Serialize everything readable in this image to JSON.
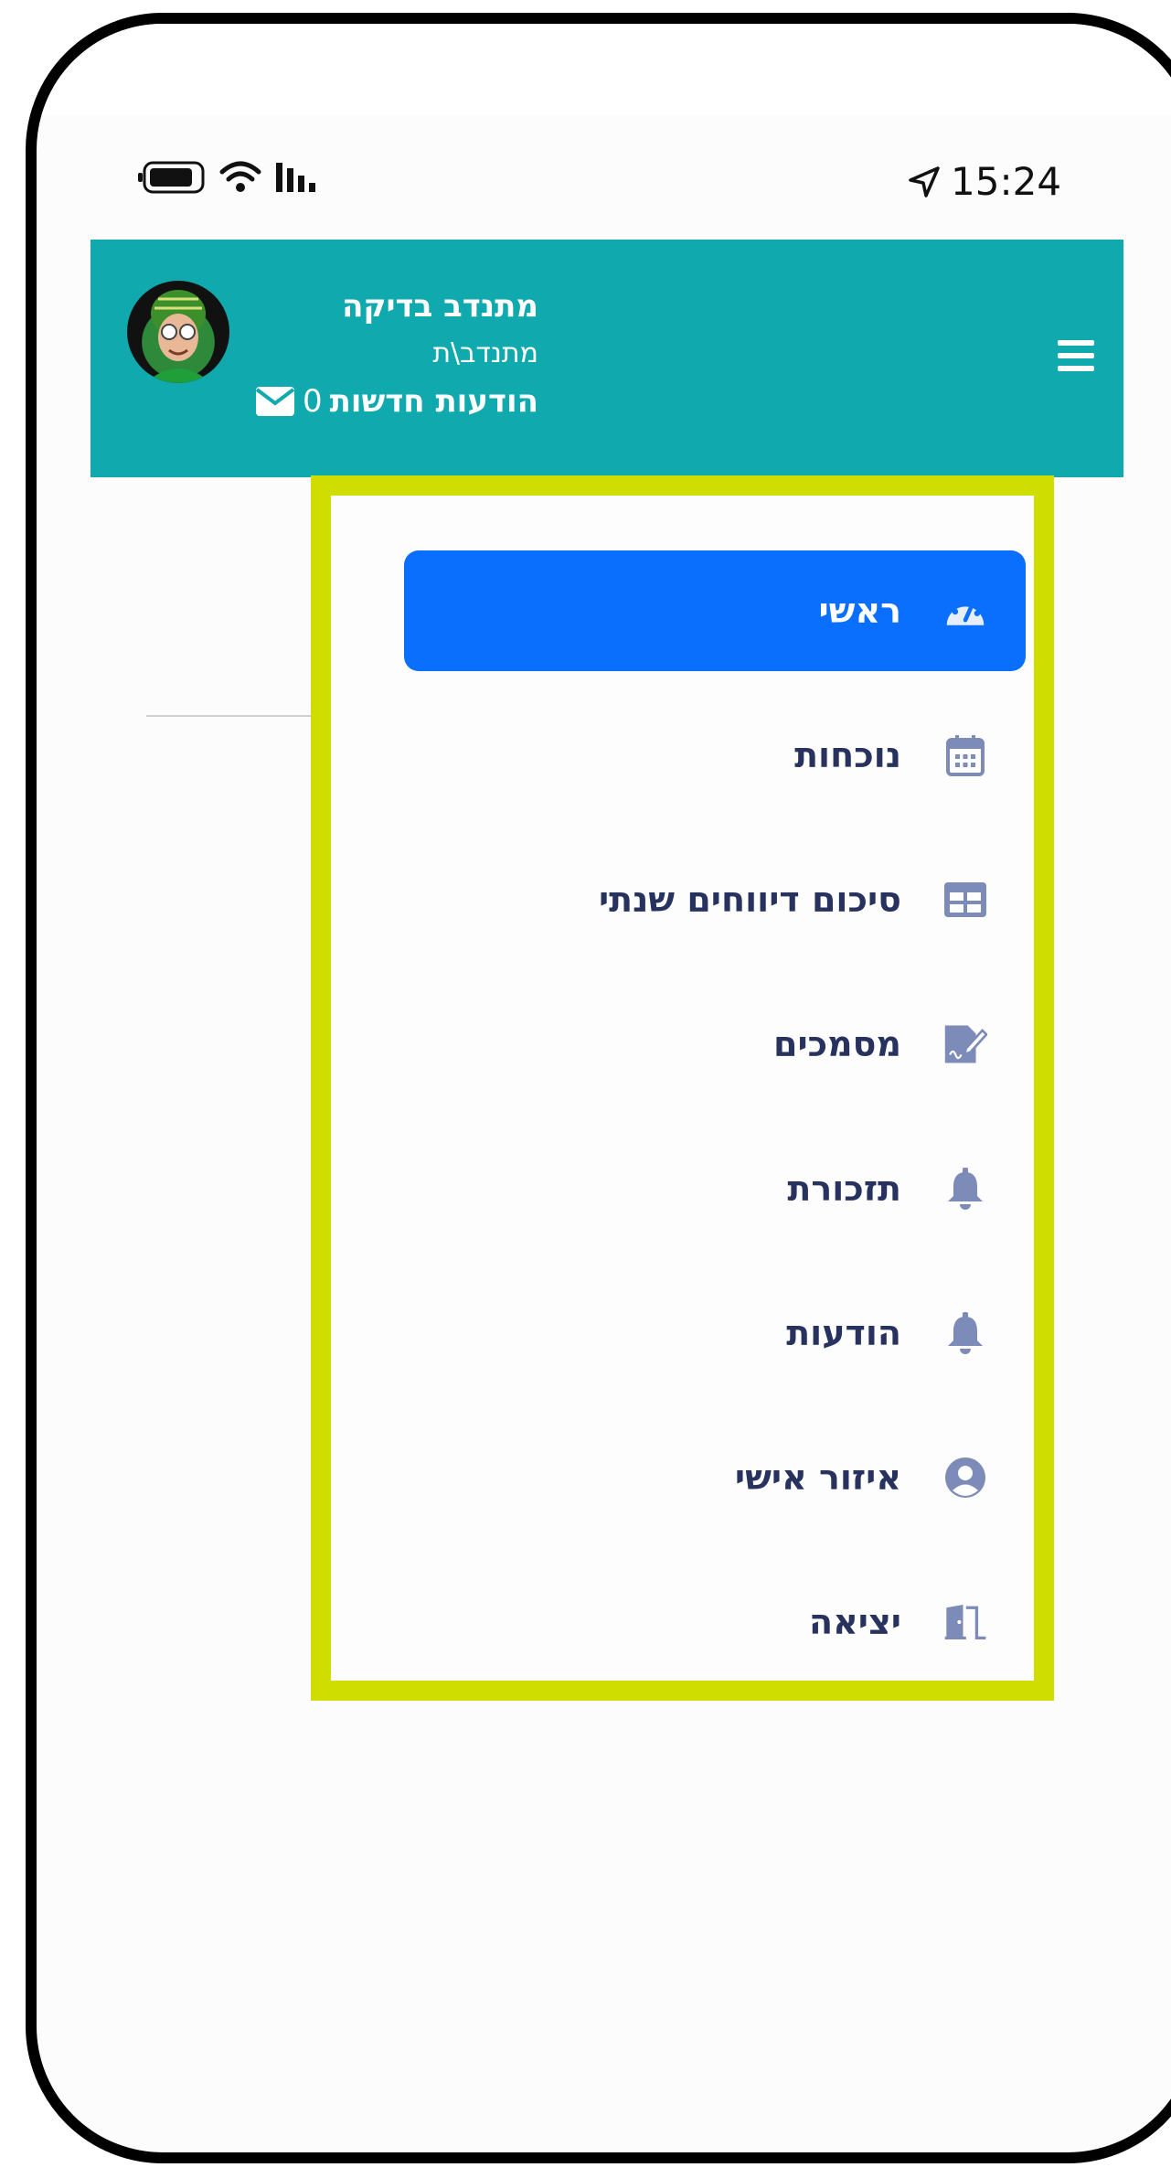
{
  "status_bar": {
    "time": "15:24"
  },
  "header": {
    "user_name": "מתנדב בדיקה",
    "user_role": "מתנדב\\ת",
    "messages_count": "0",
    "messages_label": "הודעות חדשות",
    "background_color": "#10a9ad"
  },
  "menu": {
    "items": [
      {
        "label": "ראשי",
        "icon": "dashboard-icon",
        "active": true
      },
      {
        "label": "נוכחות",
        "icon": "calendar-icon"
      },
      {
        "label": "סיכום דיווחים שנתי",
        "icon": "table-icon"
      },
      {
        "label": "מסמכים",
        "icon": "document-sign-icon"
      },
      {
        "label": "תזכורת",
        "icon": "bell-icon"
      },
      {
        "label": "הודעות",
        "icon": "bell-icon"
      },
      {
        "label": "איזור אישי",
        "icon": "user-circle-icon"
      },
      {
        "label": "יציאה",
        "icon": "door-exit-icon"
      }
    ],
    "active_color": "#0b6ffd",
    "highlight_color": "#cfdd00"
  }
}
